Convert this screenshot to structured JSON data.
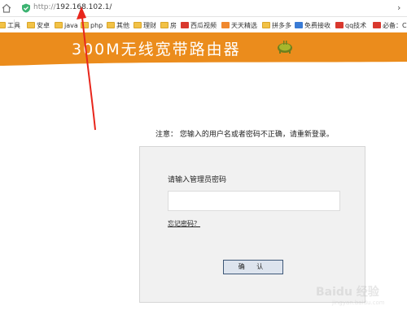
{
  "browser": {
    "url_protocol": "http://",
    "url_host": "192.168.102.1/",
    "bookmarks": [
      {
        "label": "工具",
        "icon": "folder-icon"
      },
      {
        "label": "安卓",
        "icon": "folder-icon"
      },
      {
        "label": "java",
        "icon": "folder-icon"
      },
      {
        "label": "php",
        "icon": "folder-icon"
      },
      {
        "label": "其他",
        "icon": "folder-icon"
      },
      {
        "label": "理财",
        "icon": "folder-icon"
      },
      {
        "label": "房",
        "icon": "folder-icon"
      },
      {
        "label": "西瓜视频",
        "icon": "red-site-icon"
      },
      {
        "label": "天天精选",
        "icon": "uc-icon"
      },
      {
        "label": "拼多多",
        "icon": "folder-icon"
      },
      {
        "label": "免费接收",
        "icon": "cloud-icon"
      },
      {
        "label": "qq技术",
        "icon": "qq-icon"
      },
      {
        "label": "必备：C",
        "icon": "red-site-icon"
      }
    ]
  },
  "banner": {
    "title": "300M无线宽带路由器"
  },
  "notice": {
    "text": "注意：  您输入的用户名或者密码不正确，请重新登录。"
  },
  "login": {
    "label": "请输入管理员密码",
    "password_value": "",
    "forgot_link": "忘记密码？",
    "confirm_button": "确 认"
  },
  "watermark": {
    "text": "Baidu 经验",
    "sub": "jingyan.baidu.com"
  },
  "colors": {
    "banner": "#eb8c1c",
    "annotation_arrow": "#e8261c",
    "button_border": "#3d5777"
  }
}
